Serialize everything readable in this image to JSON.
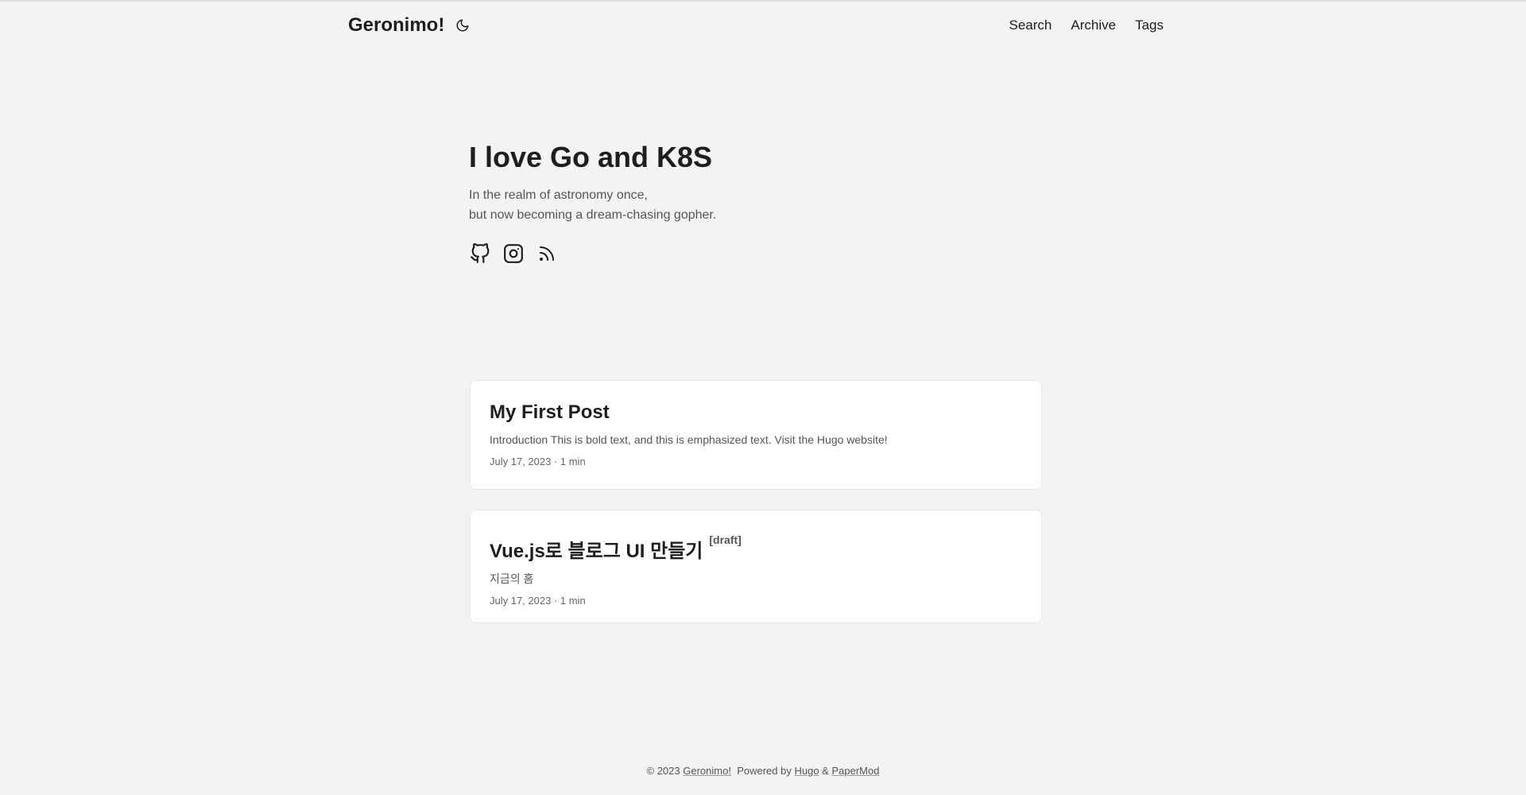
{
  "header": {
    "logo": "Geronimo!",
    "theme_icon": "moon-icon",
    "menu": [
      {
        "label": "Search"
      },
      {
        "label": "Archive"
      },
      {
        "label": "Tags"
      }
    ]
  },
  "hero": {
    "title": "I love Go and K8S",
    "subtitle_line1": "In the realm of astronomy once,",
    "subtitle_line2": "but now becoming a dream-chasing gopher.",
    "social_icons": [
      "github-icon",
      "instagram-icon",
      "rss-icon"
    ]
  },
  "posts": [
    {
      "title": "My First Post",
      "summary": "Introduction This is bold text, and this is emphasized text. Visit the Hugo website!",
      "meta": "July 17, 2023 · 1 min"
    },
    {
      "title": "Vue.js로 블로그 UI 만들기",
      "badge": "[draft]",
      "summary": "지금의 홈",
      "meta": "July 17, 2023 · 1 min"
    }
  ],
  "footer": {
    "copyright": "© 2023",
    "site_link": "Geronimo!",
    "powered_by": "Powered by",
    "hugo_link": "Hugo",
    "amp": "&",
    "theme_link": "PaperMod"
  },
  "colors": {
    "background": "#f3f3f3",
    "card": "#ffffff",
    "text": "#1e1e1e",
    "muted": "#555555"
  }
}
